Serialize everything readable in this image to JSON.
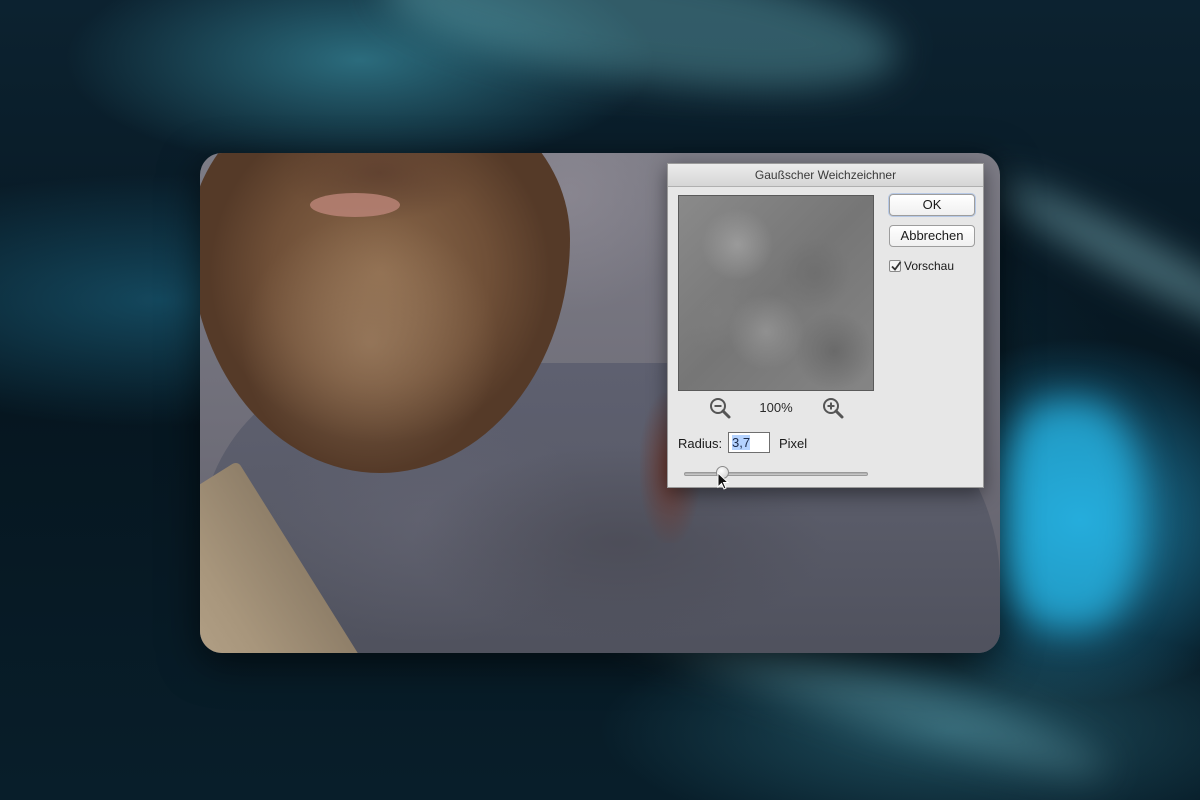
{
  "dialog": {
    "title": "Gaußscher Weichzeichner",
    "zoom_level": "100%",
    "buttons": {
      "ok_label": "OK",
      "cancel_label": "Abbrechen"
    },
    "preview_checkbox": {
      "label": "Vorschau",
      "checked": true
    },
    "radius": {
      "label": "Radius:",
      "value": "3,7",
      "unit": "Pixel"
    },
    "slider": {
      "value_fraction": 0.19
    },
    "icons": {
      "zoom_out": "zoom-out-icon",
      "zoom_in": "zoom-in-icon"
    }
  },
  "colors": {
    "dialog_bg": "#e7e7e7",
    "selection": "#b5d3ff",
    "background_accent": "#1fb2e8"
  }
}
